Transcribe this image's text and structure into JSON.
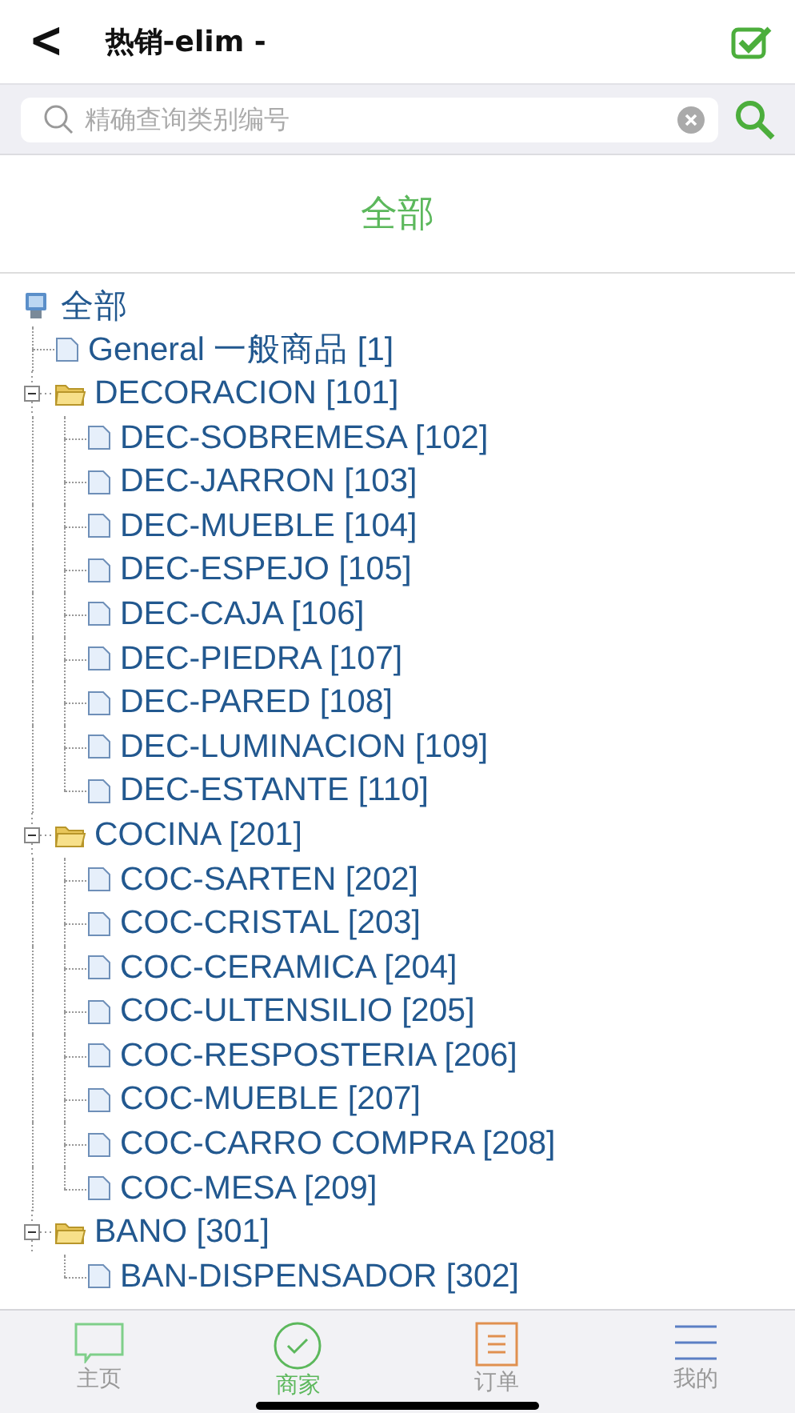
{
  "header": {
    "back": "<",
    "title": "热销-elim -"
  },
  "search": {
    "placeholder": "精确查询类别编号"
  },
  "section_title": "全部",
  "tree": {
    "kind": "root",
    "label": "全部",
    "children": [
      {
        "kind": "leaf",
        "label": "General 一般商品 [1]"
      },
      {
        "kind": "folder",
        "label": "DECORACION [101]",
        "expanded": true,
        "children": [
          {
            "kind": "leaf",
            "label": "DEC-SOBREMESA [102]"
          },
          {
            "kind": "leaf",
            "label": "DEC-JARRON [103]"
          },
          {
            "kind": "leaf",
            "label": "DEC-MUEBLE [104]"
          },
          {
            "kind": "leaf",
            "label": "DEC-ESPEJO [105]"
          },
          {
            "kind": "leaf",
            "label": "DEC-CAJA [106]"
          },
          {
            "kind": "leaf",
            "label": "DEC-PIEDRA [107]"
          },
          {
            "kind": "leaf",
            "label": "DEC-PARED [108]"
          },
          {
            "kind": "leaf",
            "label": "DEC-LUMINACION [109]"
          },
          {
            "kind": "leaf",
            "label": "DEC-ESTANTE [110]"
          }
        ]
      },
      {
        "kind": "folder",
        "label": "COCINA [201]",
        "expanded": true,
        "children": [
          {
            "kind": "leaf",
            "label": "COC-SARTEN [202]"
          },
          {
            "kind": "leaf",
            "label": "COC-CRISTAL [203]"
          },
          {
            "kind": "leaf",
            "label": "COC-CERAMICA [204]"
          },
          {
            "kind": "leaf",
            "label": "COC-ULTENSILIO [205]"
          },
          {
            "kind": "leaf",
            "label": "COC-RESPOSTERIA [206]"
          },
          {
            "kind": "leaf",
            "label": "COC-MUEBLE [207]"
          },
          {
            "kind": "leaf",
            "label": "COC-CARRO COMPRA [208]"
          },
          {
            "kind": "leaf",
            "label": "COC-MESA [209]"
          }
        ]
      },
      {
        "kind": "folder",
        "label": "BANO [301]",
        "expanded": true,
        "children": [
          {
            "kind": "leaf",
            "label": "BAN-DISPENSADOR [302]"
          }
        ]
      }
    ]
  },
  "tabbar": [
    {
      "kind": "chat",
      "label": "主页",
      "selected": false
    },
    {
      "kind": "check",
      "label": "商家",
      "selected": true
    },
    {
      "kind": "doc",
      "label": "订单",
      "selected": false
    },
    {
      "kind": "menu",
      "label": "我的",
      "selected": false
    }
  ]
}
